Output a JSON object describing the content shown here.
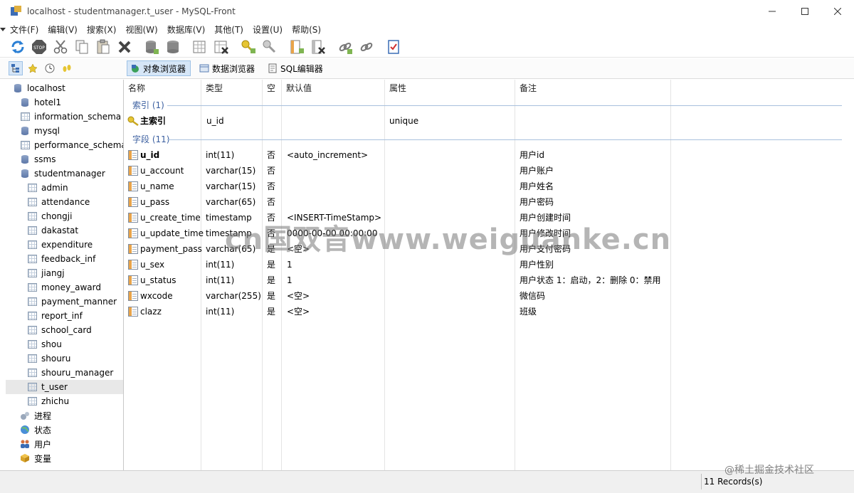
{
  "window": {
    "title": "localhost - studentmanager.t_user - MySQL-Front"
  },
  "menu": [
    "文件(F)",
    "编辑(V)",
    "搜索(X)",
    "视图(W)",
    "数据库(V)",
    "其他(T)",
    "设置(U)",
    "帮助(S)"
  ],
  "toolbar": {
    "icons": [
      "refresh-icon",
      "stop-icon",
      "cut-icon",
      "copy-icon",
      "paste-icon",
      "delete-icon",
      "database-add-icon",
      "database-delete-icon",
      "table-add-icon",
      "table-delete-icon",
      "key-add-icon",
      "key-delete-icon",
      "field-add-icon",
      "field-delete-icon",
      "link-add-icon",
      "link-delete-icon",
      "checklist-icon"
    ]
  },
  "views": {
    "object_browser": "对象浏览器",
    "data_browser": "数据浏览器",
    "sql_editor": "SQL编辑器"
  },
  "tree": {
    "root": "localhost",
    "databases": [
      "hotel1",
      "information_schema",
      "mysql",
      "performance_schema",
      "ssms",
      "studentmanager"
    ],
    "tables": [
      "admin",
      "attendance",
      "chongji",
      "dakastat",
      "expenditure",
      "feedback_inf",
      "jiangj",
      "money_award",
      "payment_manner",
      "report_inf",
      "school_card",
      "shou",
      "shouru",
      "shouru_manager",
      "t_user",
      "zhichu"
    ],
    "selected": "t_user",
    "extras": [
      "进程",
      "状态",
      "用户",
      "变量"
    ]
  },
  "grid": {
    "headers": [
      "名称",
      "类型",
      "空",
      "默认值",
      "属性",
      "备注"
    ],
    "index_group": "索引 (1)",
    "index_row": {
      "name": "主索引",
      "type": "u_id",
      "attr": "unique"
    },
    "field_group": "字段 (11)",
    "fields": [
      {
        "name": "u_id",
        "type": "int(11)",
        "null": "否",
        "default": "<auto_increment>",
        "comment": "用户id"
      },
      {
        "name": "u_account",
        "type": "varchar(15)",
        "null": "否",
        "default": "",
        "comment": "用户账户"
      },
      {
        "name": "u_name",
        "type": "varchar(15)",
        "null": "否",
        "default": "",
        "comment": "用户姓名"
      },
      {
        "name": "u_pass",
        "type": "varchar(65)",
        "null": "否",
        "default": "",
        "comment": "用户密码"
      },
      {
        "name": "u_create_time",
        "type": "timestamp",
        "null": "否",
        "default": "<INSERT-TimeStamp>",
        "comment": "用户创建时间"
      },
      {
        "name": "u_update_time",
        "type": "timestamp",
        "null": "否",
        "default": "0000-00-00 00:00:00",
        "comment": "用户修改时间"
      },
      {
        "name": "payment_pass",
        "type": "varchar(65)",
        "null": "是",
        "default": "<空>",
        "comment": "用户支付密码"
      },
      {
        "name": "u_sex",
        "type": "int(11)",
        "null": "是",
        "default": "1",
        "comment": "用户性别"
      },
      {
        "name": "u_status",
        "type": "int(11)",
        "null": "是",
        "default": "1",
        "comment": "用户状态 1：启动，2：删除 0：禁用"
      },
      {
        "name": "wxcode",
        "type": "varchar(255)",
        "null": "是",
        "default": "<空>",
        "comment": "微信码"
      },
      {
        "name": "clazz",
        "type": "int(11)",
        "null": "是",
        "default": "<空>",
        "comment": "班级"
      }
    ]
  },
  "status": {
    "records": "11 Records(s)"
  },
  "watermarks": {
    "center": "cn国双音www.weiguanke.cn",
    "corner": "@稀土掘金技术社区"
  }
}
